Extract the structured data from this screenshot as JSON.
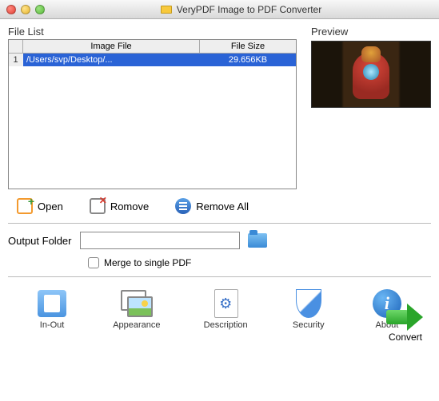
{
  "window": {
    "title": "VeryPDF Image to PDF Converter"
  },
  "file_list": {
    "label": "File List",
    "headers": {
      "image_file": "Image File",
      "file_size": "File Size"
    },
    "rows": [
      {
        "n": "1",
        "file": "/Users/svp/Desktop/...",
        "size": "29.656KB"
      }
    ]
  },
  "preview": {
    "label": "Preview"
  },
  "buttons": {
    "open": "Open",
    "remove": "Romove",
    "remove_all": "Remove All",
    "convert": "Convert"
  },
  "output": {
    "label": "Output Folder",
    "value": "",
    "merge_label": "Merge to single PDF"
  },
  "tabs": {
    "in_out": "In-Out",
    "appearance": "Appearance",
    "description": "Description",
    "security": "Security",
    "about": "About"
  }
}
